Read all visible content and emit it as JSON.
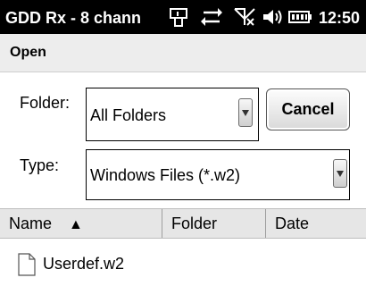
{
  "statusbar": {
    "title": "GDD Rx - 8 chann",
    "time": "12:50",
    "icons": [
      "phone-icon",
      "sync-arrows-icon",
      "no-signal-icon",
      "speaker-icon",
      "battery-icon"
    ]
  },
  "menu": {
    "open_label": "Open"
  },
  "form": {
    "folder_label": "Folder:",
    "folder_value": "All Folders",
    "cancel_label": "Cancel",
    "type_label": "Type:",
    "type_value": "Windows Files (*.w2)"
  },
  "table": {
    "columns": [
      "Name",
      "Folder",
      "Date"
    ],
    "sort_glyph": "▲",
    "rows": [
      {
        "name": "Userdef.w2",
        "icon": "file-icon"
      }
    ]
  },
  "colors": {
    "statusbar_bg": "#000000",
    "menubar_bg": "#ededed",
    "header_bg": "#e6e6e6"
  }
}
